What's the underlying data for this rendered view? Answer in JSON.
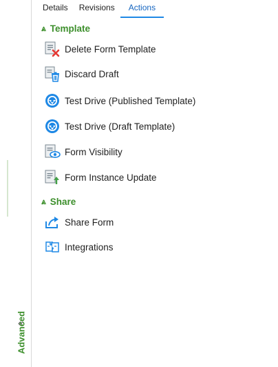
{
  "tabs": [
    {
      "label": "Details",
      "active": false
    },
    {
      "label": "Revisions",
      "active": false
    },
    {
      "label": "Actions",
      "active": true
    }
  ],
  "rail": {
    "label": "Advanced",
    "chevron": "«"
  },
  "sections": {
    "template": {
      "title": "Template",
      "chevron": "⩓",
      "items": [
        {
          "label": "Delete Form Template",
          "icon": "delete-form-template-icon"
        },
        {
          "label": "Discard Draft",
          "icon": "discard-draft-icon"
        },
        {
          "label": "Test Drive (Published Template)",
          "icon": "steering-wheel-icon"
        },
        {
          "label": "Test Drive (Draft Template)",
          "icon": "steering-wheel-icon"
        },
        {
          "label": "Form Visibility",
          "icon": "form-visibility-icon"
        },
        {
          "label": "Form Instance Update",
          "icon": "form-instance-update-icon"
        }
      ]
    },
    "share": {
      "title": "Share",
      "chevron": "⩓",
      "items": [
        {
          "label": "Share Form",
          "icon": "share-icon"
        },
        {
          "label": "Integrations",
          "icon": "integrations-icon"
        }
      ]
    }
  },
  "colors": {
    "accent_green": "#3d8f2c",
    "tab_active": "#1565c0",
    "icon_blue": "#1e88e5"
  }
}
